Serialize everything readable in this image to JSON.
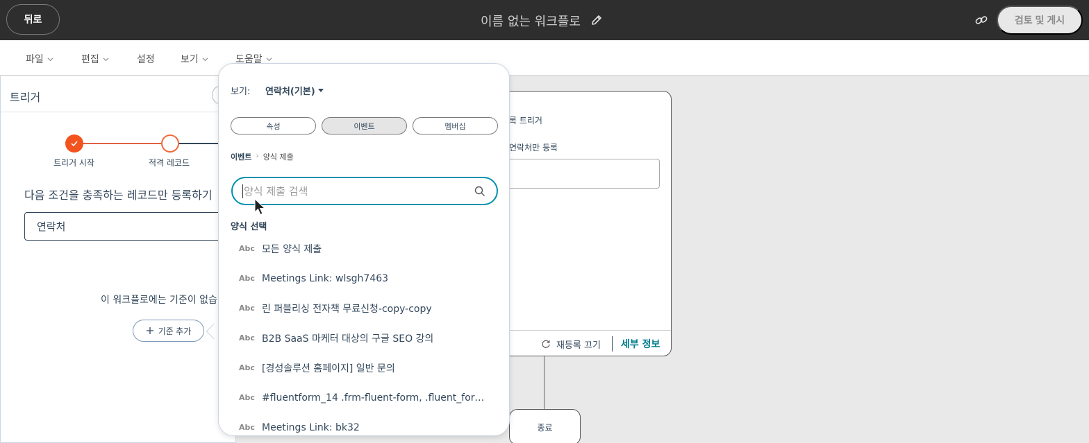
{
  "topbar": {
    "back_label": "뒤로",
    "workflow_title": "이름 없는 워크플로",
    "publish_label": "검토 및 게시"
  },
  "menu": {
    "items": [
      {
        "label": "파일",
        "has_dropdown": true
      },
      {
        "label": "편집",
        "has_dropdown": true
      },
      {
        "label": "설정",
        "has_dropdown": false
      },
      {
        "label": "보기",
        "has_dropdown": true
      },
      {
        "label": "도움말",
        "has_dropdown": true
      }
    ]
  },
  "left_panel": {
    "title": "트리거",
    "steps": [
      "트리거 시작",
      "적격 레코드"
    ],
    "condition_title": "다음 조건을 충족하는 레코드만 등록하기",
    "object_value": "연락처",
    "no_criteria_text": "이 워크플로에는 기준이 없습니",
    "add_criteria_label": "기준 추가"
  },
  "card": {
    "trigger_text": "록 트리거",
    "register_text": "연락처만 등록",
    "reenroll_label": "재등록 끄기",
    "details_label": "세부 정보"
  },
  "end_node": {
    "label": "종료"
  },
  "popover": {
    "view_label": "보기:",
    "view_value": "연락처(기본)",
    "tabs": [
      {
        "label": "속성",
        "active": false
      },
      {
        "label": "이벤트",
        "active": true
      },
      {
        "label": "멤버십",
        "active": false
      }
    ],
    "breadcrumb": {
      "root": "이벤트",
      "separator": "›",
      "current": "양식 제출"
    },
    "search_placeholder": "양식 제출 검색",
    "section_label": "양식 선택",
    "type_badge": "Abc",
    "options": [
      "모든 양식 제출",
      "Meetings Link: wlsgh7463",
      "린 퍼블리싱 전자책 무료신청-copy-copy",
      "B2B SaaS 마케터 대상의 구글 SEO 강의",
      "[경성솔루션 홈페이지] 일반 문의",
      "#fluentform_14 .frm-fluent-form, .fluent_form...",
      "Meetings Link: bk32"
    ]
  },
  "colors": {
    "topbar_bg": "#2e2e2e",
    "accent_orange": "#f3531f",
    "focus_blue": "#0091ae",
    "link_teal": "#007a8c"
  }
}
